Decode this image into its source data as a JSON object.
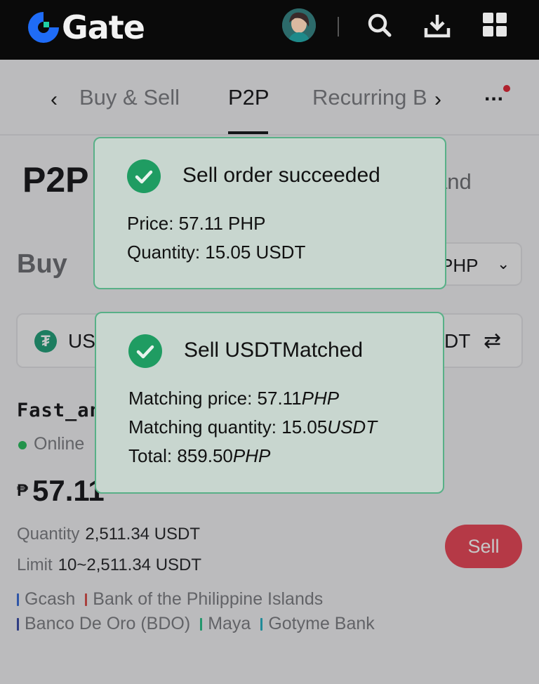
{
  "header": {
    "logo_text": "Gate",
    "logo_color": "#1f6cf7",
    "icons": [
      "avatar",
      "search-icon",
      "download-icon",
      "grid-icon"
    ]
  },
  "tabs": {
    "items": [
      {
        "label": "Buy & Sell",
        "active": false
      },
      {
        "label": "P2P",
        "active": true
      },
      {
        "label": "Recurring B",
        "active": false
      }
    ],
    "more_label": "..."
  },
  "page": {
    "title": "P2P",
    "title_suffix": "and",
    "buy_label": "Buy",
    "currency": "PHP",
    "coin_left": "USI",
    "coin_right": "DT"
  },
  "listing": {
    "merchant": "Fast_an",
    "status": "Online",
    "price_symbol": "₱",
    "price": "57.11",
    "quantity_label": "Quantity",
    "quantity_value": "2,511.34 USDT",
    "limit_label": "Limit",
    "limit_value": "10~2,511.34 USDT",
    "action_label": "Sell",
    "payment_methods": [
      {
        "name": "Gcash",
        "color": "#3d6fd6"
      },
      {
        "name": "Bank of the Philippine Islands",
        "color": "#d9534f"
      },
      {
        "name": "Banco De Oro (BDO)",
        "color": "#3d4fa8"
      },
      {
        "name": "Maya",
        "color": "#2fc28c"
      },
      {
        "name": "Gotyme Bank",
        "color": "#2ab3c4"
      }
    ]
  },
  "toast_order": {
    "title": "Sell order succeeded",
    "price_line": "Price: 57.11 PHP",
    "quantity_line": "Quantity: 15.05 USDT"
  },
  "toast_matched": {
    "title": "Sell USDTMatched",
    "price_label": "Matching price: 57.11",
    "price_unit": "PHP",
    "quantity_label": "Matching quantity: 15.05",
    "quantity_unit": "USDT",
    "total_label": "Total: 859.50",
    "total_unit": "PHP"
  }
}
